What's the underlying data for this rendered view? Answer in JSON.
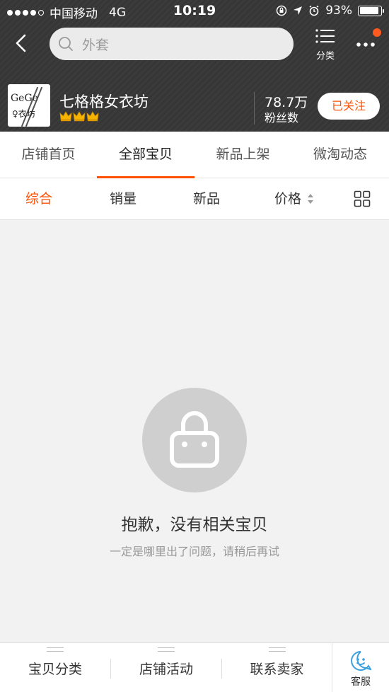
{
  "status_bar": {
    "carrier": "中国移动",
    "network": "4G",
    "time": "10:19",
    "battery": "93%",
    "battery_level": 0.93
  },
  "nav": {
    "search_placeholder": "外套",
    "category_label": "分类"
  },
  "shop": {
    "name": "七格格女衣坊",
    "logo_line1": "GeGe",
    "logo_line2": "♀衣坊",
    "crown_count": 3,
    "fans_count": "78.7万",
    "fans_label": "粉丝数",
    "follow_label": "已关注"
  },
  "tabs": [
    {
      "label": "店铺首页",
      "active": false
    },
    {
      "label": "全部宝贝",
      "active": true
    },
    {
      "label": "新品上架",
      "active": false
    },
    {
      "label": "微淘动态",
      "active": false
    }
  ],
  "sort": [
    {
      "label": "综合",
      "active": true
    },
    {
      "label": "销量",
      "active": false
    },
    {
      "label": "新品",
      "active": false
    },
    {
      "label": "价格",
      "active": false
    }
  ],
  "empty_state": {
    "title": "抱歉，没有相关宝贝",
    "subtitle": "一定是哪里出了问题，请稍后再试"
  },
  "bottom_bar": {
    "items": [
      {
        "label": "宝贝分类"
      },
      {
        "label": "店铺活动"
      },
      {
        "label": "联系卖家"
      }
    ],
    "service_label": "客服"
  },
  "colors": {
    "accent": "#ff5000",
    "header_bg": "#383838",
    "notification_dot": "#ff5a1f"
  }
}
